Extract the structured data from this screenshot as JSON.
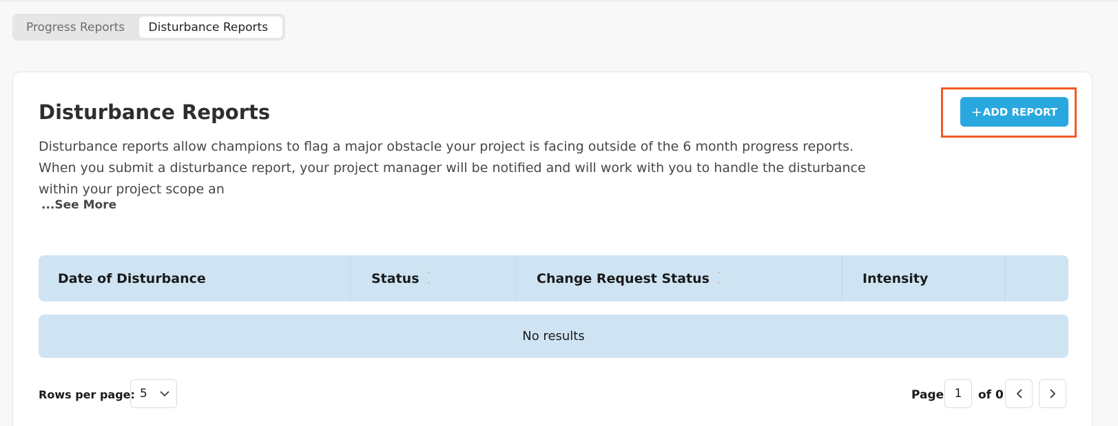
{
  "tabs": [
    {
      "label": "Progress Reports",
      "active": false
    },
    {
      "label": "Disturbance Reports",
      "active": true
    }
  ],
  "card": {
    "title": "Disturbance Reports",
    "description": "Disturbance reports allow champions to flag a major obstacle your project is facing outside of the 6 month progress reports. When you submit a disturbance report, your project manager will be notified and will work with you to handle the disturbance within your project scope an",
    "see_more": "...See More",
    "add_button": {
      "icon": "+",
      "label": "ADD REPORT"
    }
  },
  "table": {
    "columns": [
      {
        "label": "Date of Disturbance",
        "sortable": false
      },
      {
        "label": "Status",
        "sortable": true
      },
      {
        "label": "Change Request Status",
        "sortable": true
      },
      {
        "label": "Intensity",
        "sortable": false
      },
      {
        "label": "",
        "sortable": false
      }
    ],
    "empty_text": "No results"
  },
  "pagination": {
    "rows_label": "Rows per page:",
    "rows_value": "5",
    "page_label": "Page",
    "page_value": "1",
    "of_label": "of 0"
  },
  "colors": {
    "accent": "#29a8df",
    "highlight": "#f05a22",
    "table_header_bg": "#cfe4f3"
  },
  "icons": {
    "add": "plus-icon",
    "sort": "sort-icon",
    "dropdown": "chevron-down-icon",
    "prev": "chevron-left-icon",
    "next": "chevron-right-icon"
  }
}
